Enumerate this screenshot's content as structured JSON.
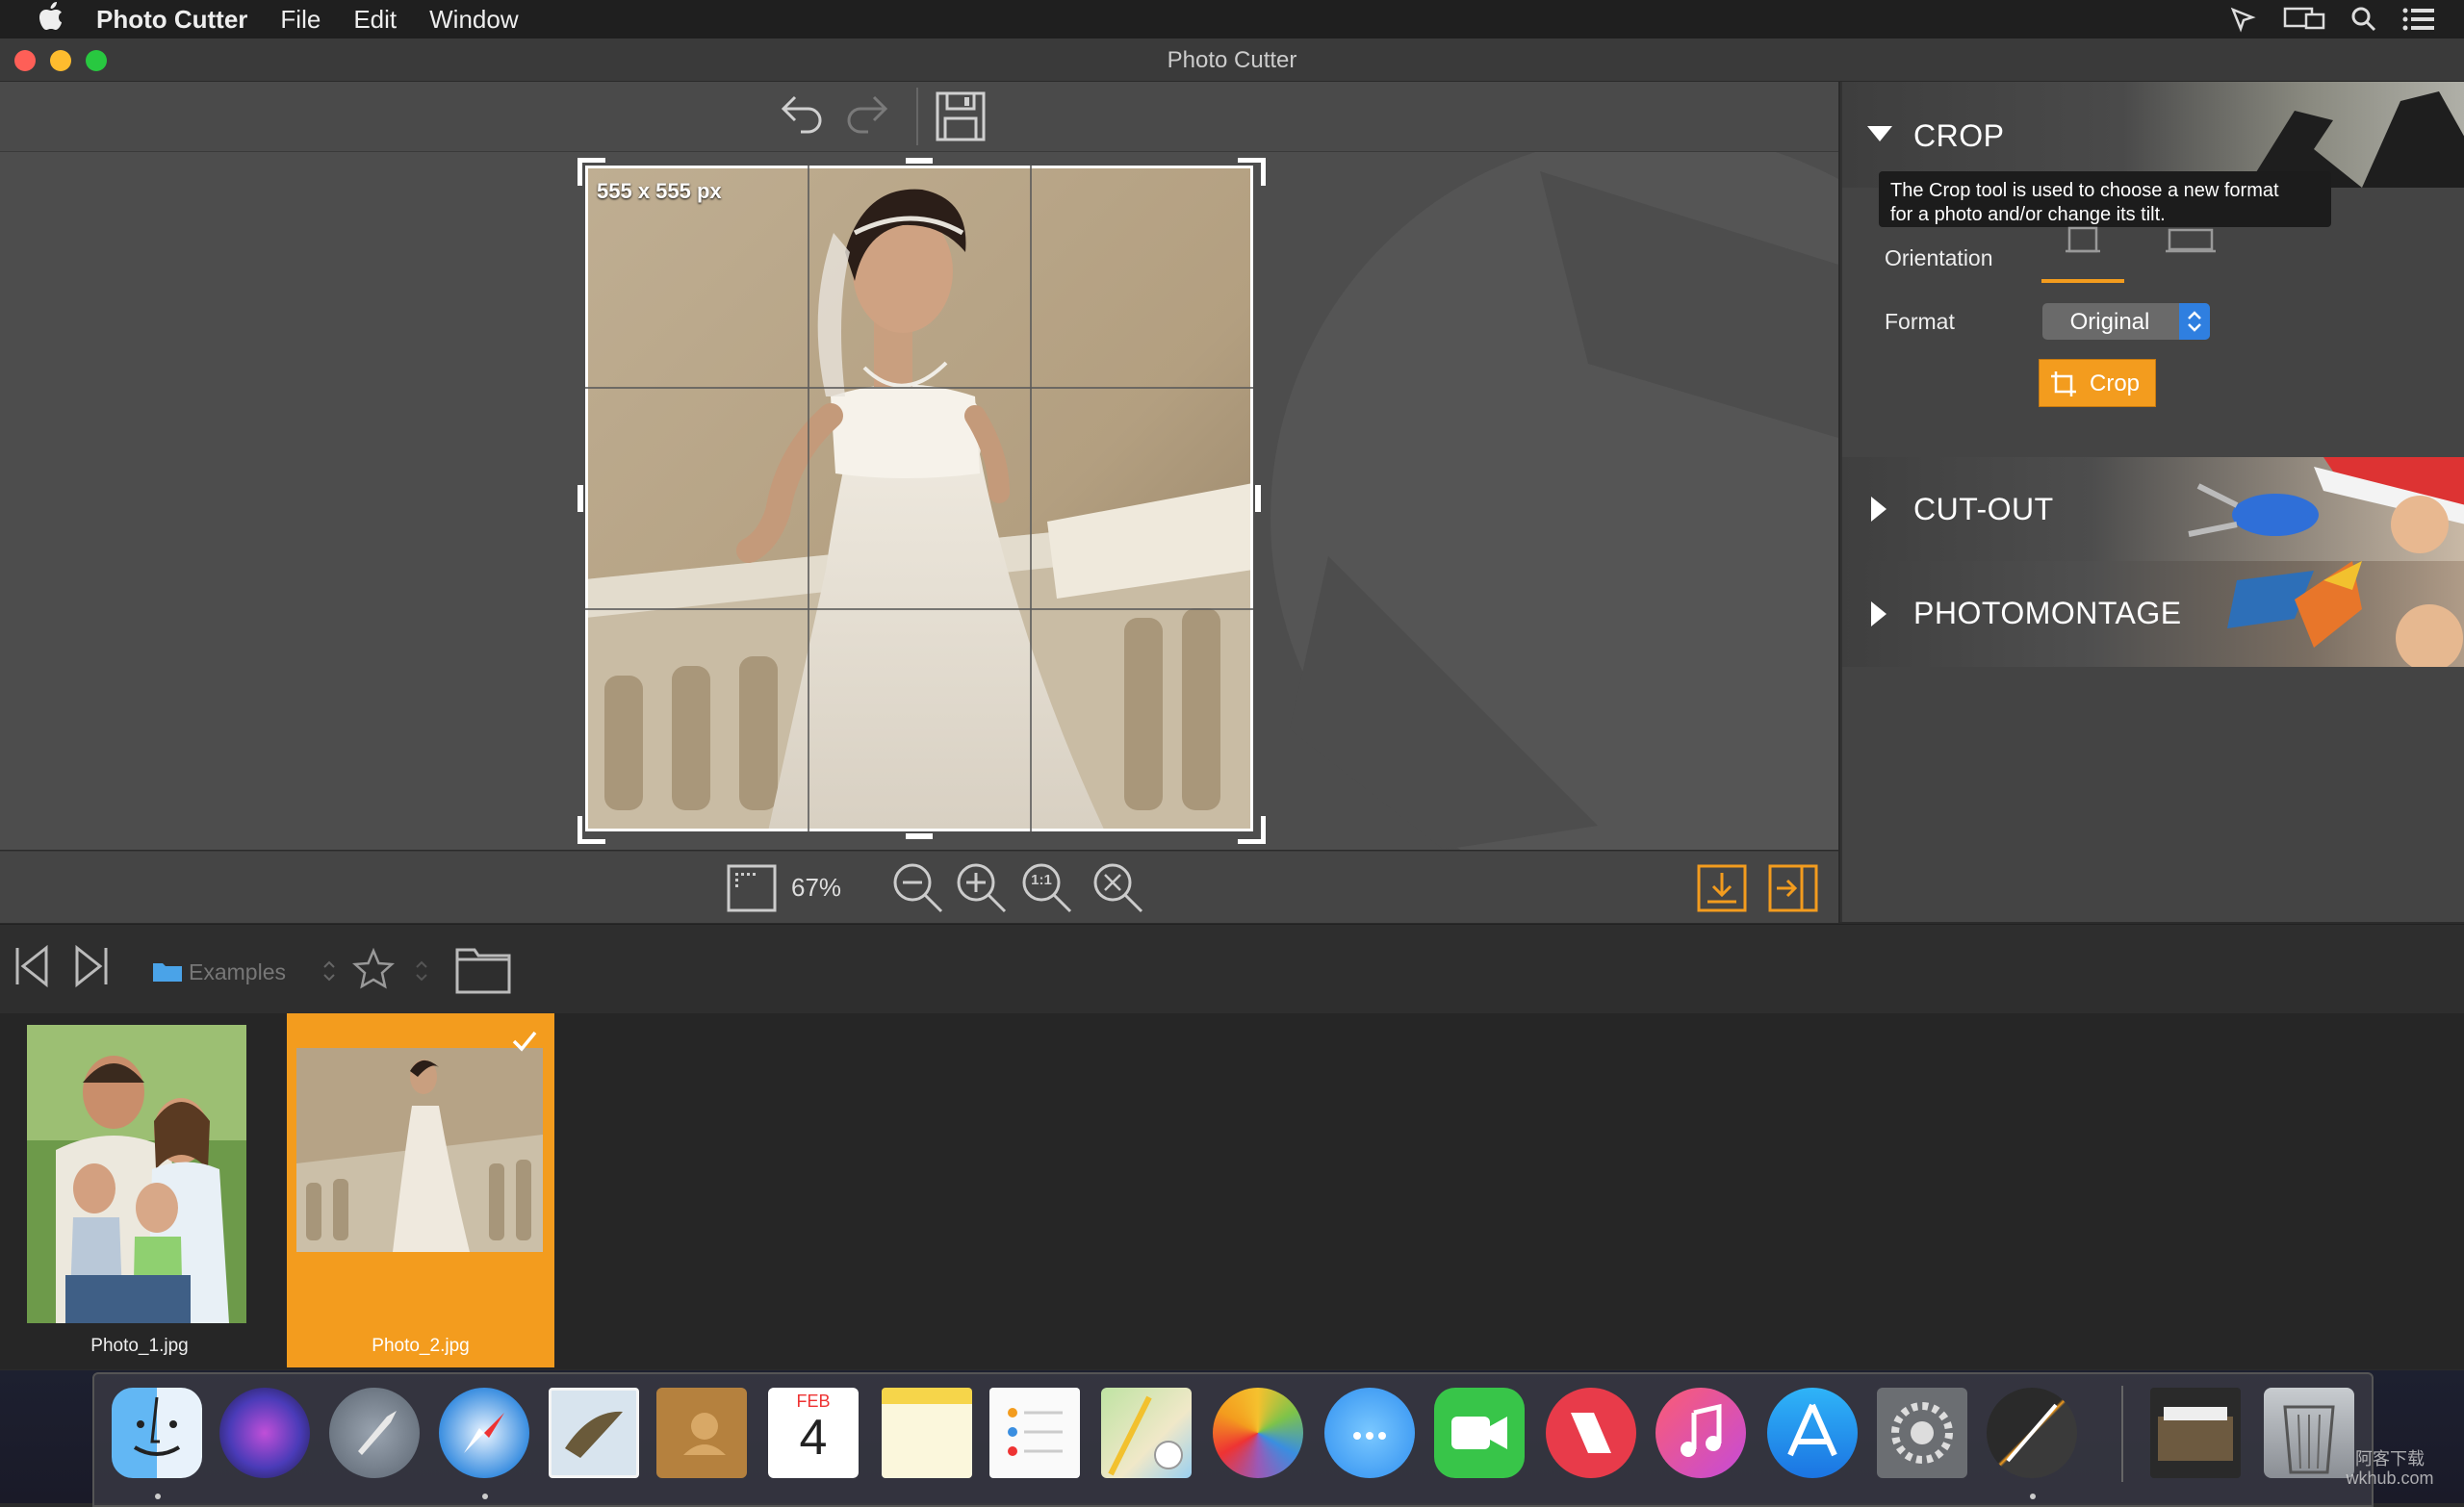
{
  "menu": {
    "apple": "",
    "app_name": "Photo Cutter",
    "items": [
      "File",
      "Edit",
      "Window"
    ]
  },
  "window": {
    "title": "Photo Cutter"
  },
  "canvas": {
    "size_label": "555 x 555 px"
  },
  "zoom": {
    "level": "67%",
    "one_to_one": "1:1"
  },
  "panel": {
    "crop": {
      "title": "CROP",
      "tooltip_line1": "The Crop tool is used to choose a new format",
      "tooltip_line2": "for a photo and/or change its tilt.",
      "orientation_label": "Orientation",
      "format_label": "Format",
      "format_value": "Original",
      "crop_button": "Crop"
    },
    "cutout": {
      "title": "CUT-OUT"
    },
    "photomontage": {
      "title": "PHOTOMONTAGE"
    }
  },
  "browser": {
    "folder": "Examples",
    "thumbnails": [
      {
        "name": "Photo_1.jpg",
        "selected": false
      },
      {
        "name": "Photo_2.jpg",
        "selected": true
      }
    ]
  },
  "dock": {
    "calendar_month": "FEB",
    "calendar_day": "4"
  },
  "watermark": {
    "line1": "阿客下载",
    "line2": "wkhub.com"
  },
  "colors": {
    "accent": "#f39c1e",
    "menubar": "#1f1f1f",
    "panel": "#444444",
    "canvas": "#4d4d4d"
  }
}
